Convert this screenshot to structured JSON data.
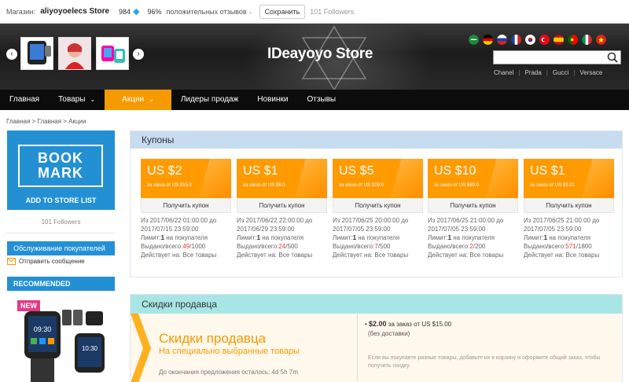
{
  "topbar": {
    "store_label": "Магазин:",
    "store_name": "aliyoyoelecs Store",
    "score": "984",
    "positive_pct": "96%",
    "positive_label": "положительных отзывов",
    "save_label": "Сохранить",
    "followers": "101 Followers"
  },
  "banner": {
    "brand": "IDeayoyo Store",
    "hot_links": [
      "Chanel",
      "Prada",
      "Gucci",
      "Versace"
    ],
    "flags": [
      "sa",
      "de",
      "ru",
      "fr",
      "kr",
      "tr",
      "es",
      "pt",
      "it",
      "vn"
    ],
    "search_placeholder": ""
  },
  "nav": {
    "items": [
      "Главная",
      "Товары",
      "Акции",
      "Лидеры продаж",
      "Новинки",
      "Отзывы"
    ],
    "active": "Акции"
  },
  "breadcrumb": "Главная > Главная > Акции",
  "sidebar": {
    "bookmark_line1": "BOOK",
    "bookmark_line2": "MARK",
    "add_to_store": "ADD TO STORE LIST",
    "followers": "101 Followers",
    "service": "Обслуживание покупателей",
    "send_message": "Отправить сообщение",
    "recommended": "RECOMMENDED",
    "new_badge": "NEW"
  },
  "coupons": {
    "heading": "Купоны",
    "button_label": "Получить купон",
    "items": [
      {
        "amount": "US $2",
        "min": "за заказ от US $15.0",
        "from": "Из 2017/06/22 01:00:00 до",
        "to": "2017/07/15 23:59:00",
        "limit_label": "Лимит:",
        "limit": "1",
        "limit_suffix": " на покупателя",
        "issued_label": "Выдано/всего:",
        "issued": "49",
        "total": "/1000",
        "valid": "Действует на: Все товары"
      },
      {
        "amount": "US $1",
        "min": "за заказ от US $8.0",
        "from": "Из 2017/06/22 22:00:00 до",
        "to": "2017/06/29 23:59:00",
        "limit_label": "Лимит:",
        "limit": "1",
        "limit_suffix": " на покупателя",
        "issued_label": "Выдано/всего:",
        "issued": "24",
        "total": "/500",
        "valid": "Действует на: Все товары"
      },
      {
        "amount": "US $5",
        "min": "за заказ от US $29.0",
        "from": "Из 2017/06/25 20:00:00 до",
        "to": "2017/07/05 23:59:00",
        "limit_label": "Лимит:",
        "limit": "1",
        "limit_suffix": " на покупателя",
        "issued_label": "Выдано/всего:",
        "issued": "7",
        "total": "/500",
        "valid": "Действует на: Все товары"
      },
      {
        "amount": "US $10",
        "min": "за заказ от US $69.0",
        "from": "Из 2017/06/25 21:00:00 до",
        "to": "2017/07/05 23:59:00",
        "limit_label": "Лимит:",
        "limit": "1",
        "limit_suffix": " на покупателя",
        "issued_label": "Выдано/всего:",
        "issued": "2",
        "total": "/200",
        "valid": "Действует на: Все товары"
      },
      {
        "amount": "US $1",
        "min": "за заказ от US $1.01",
        "from": "Из 2017/06/25 21:00:00 до",
        "to": "2017/07/05 23:59:00",
        "limit_label": "Лимит:",
        "limit": "1",
        "limit_suffix": " на покупателя",
        "issued_label": "Выдано/всего:",
        "issued": "571",
        "total": "/1800",
        "valid": "Действует на: Все товары"
      }
    ]
  },
  "discounts": {
    "heading": "Скидки продавца",
    "title": "Скидки продавца",
    "subtitle": "На специально выбранные товары",
    "remaining": "До окончания предложения осталось: 4d 5h 7m",
    "offer_amount": "$2.00",
    "offer_rest": " за заказ от US $15.00",
    "no_delivery": "(без доставки)",
    "note": "Если вы покупаете разные товары, добавьте их в корзину и оформите общий заказ, чтобы получить скидку."
  },
  "colors": {
    "accent": "#f59a00",
    "brand_blue": "#2390d4",
    "nav_bg": "#0c0c0c",
    "coupon_head": "#c7dcef",
    "discount_head": "#a8e6e6"
  }
}
